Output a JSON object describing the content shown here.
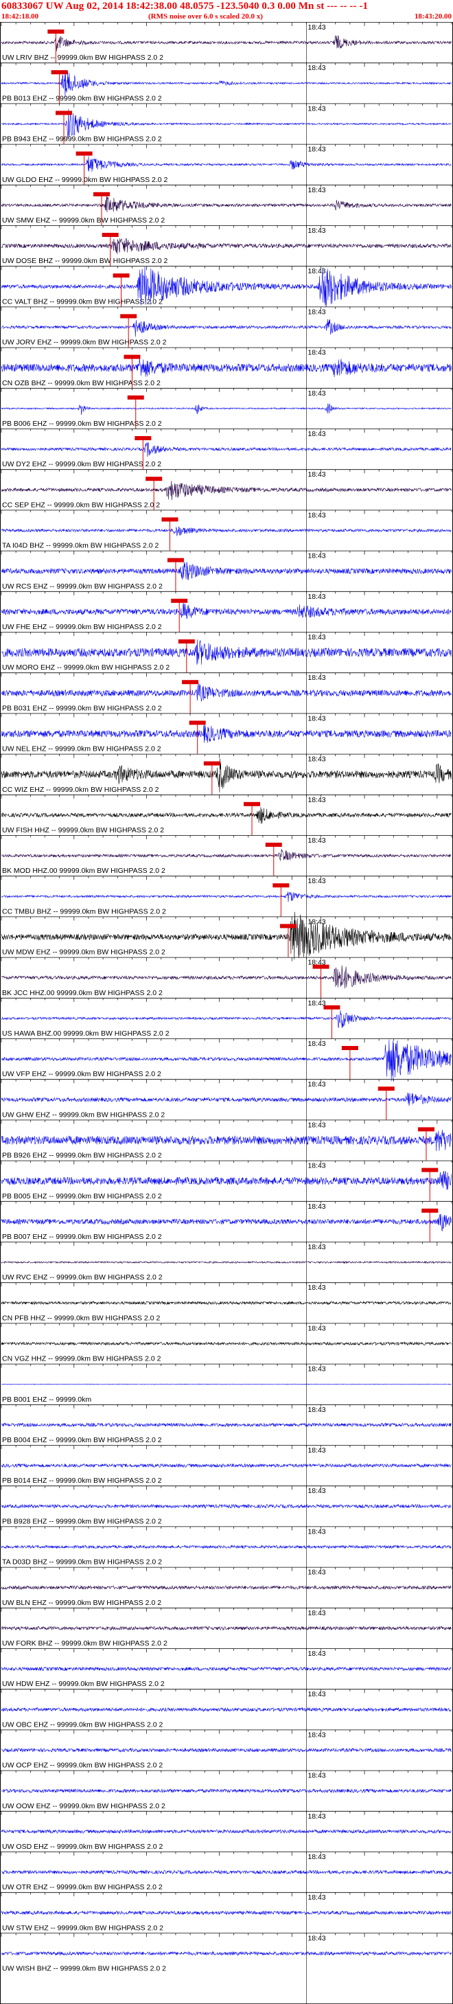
{
  "header": {
    "title": "60833067 UW Aug 02, 2014 18:42:38.00   48.0575 -123.5040   0.3 0.00 Mn st --- -- --   -1",
    "subtitle": "(RMS noise over 6.0 s scaled 20.0 x)",
    "time_start": "18:42:18.00",
    "time_end": "18:43:20.00"
  },
  "colors": {
    "header_red": "#ee0000",
    "trace_blue": "#0000ee",
    "trace_dark": "#220044",
    "trace_black": "#000000",
    "pick": "#dd0000",
    "grid": "#000000"
  },
  "chart_data": {
    "type": "seismogram",
    "title": "60833067 UW Aug 02, 2014 18:42:38.00   48.0575 -123.5040   0.3 0.00 Mn st --- -- --   -1",
    "subtitle": "(RMS noise over 6.0 s scaled 20.0 x)",
    "x_range_seconds": [
      0,
      62
    ],
    "time_axis": {
      "start": "18:42:18.00",
      "end": "18:43:20.00",
      "minute_mark": "18:43",
      "minute_mark_seconds": 42
    },
    "grid": true,
    "series": [
      {
        "label": "UW LRIV BHZ -- 99999.0km BW  HIGHPASS  2.0  2",
        "color": "dark",
        "pick_seconds": 7.5,
        "amp": 0.35,
        "noise": 0.1,
        "bursts": [
          [
            7.6,
            1.4,
            0.55
          ],
          [
            46,
            1.5,
            0.5
          ]
        ]
      },
      {
        "label": "PB B013 EHZ -- 99999.0km BW  HIGHPASS  2.0  2",
        "color": "blue",
        "pick_seconds": 8.0,
        "amp": 0.35,
        "noise": 0.06,
        "bursts": [
          [
            8.6,
            2.2,
            1.0
          ],
          [
            30,
            2,
            0.15
          ]
        ]
      },
      {
        "label": "PB B943 EHZ -- 99999.0km BW  HIGHPASS  2.0  2",
        "color": "blue",
        "pick_seconds": 8.6,
        "amp": 0.35,
        "noise": 0.06,
        "bursts": [
          [
            9.2,
            2.5,
            1.1
          ]
        ]
      },
      {
        "label": "UW GLDO EHZ -- 99999.0km BW  HIGHPASS  2.0  2",
        "color": "blue",
        "pick_seconds": 11.4,
        "amp": 0.35,
        "noise": 0.07,
        "bursts": [
          [
            12,
            2.5,
            0.6
          ],
          [
            40,
            1.5,
            0.35
          ]
        ]
      },
      {
        "label": "UW SMW EHZ -- 99999.0km BW  HIGHPASS  2.0  2",
        "color": "dark",
        "pick_seconds": 13.8,
        "amp": 0.35,
        "noise": 0.1,
        "bursts": [
          [
            14.5,
            3,
            0.6
          ],
          [
            46,
            2,
            0.3
          ]
        ]
      },
      {
        "label": "UW DOSE BHZ -- 99999.0km BW  HIGHPASS  2.0  2",
        "color": "dark",
        "pick_seconds": 15.0,
        "amp": 0.35,
        "noise": 0.14,
        "bursts": [
          [
            15.5,
            5,
            0.55
          ]
        ]
      },
      {
        "label": "CC VALT BHZ -- 99999.0km BW  HIGHPASS  2.0  2",
        "color": "blue",
        "pick_seconds": 16.5,
        "amp": 0.4,
        "noise": 0.12,
        "bursts": [
          [
            19,
            6,
            1.3
          ],
          [
            44,
            4,
            1.4
          ]
        ]
      },
      {
        "label": "UW JORV EHZ -- 99999.0km BW  HIGHPASS  2.0  2",
        "color": "blue",
        "pick_seconds": 17.5,
        "amp": 0.35,
        "noise": 0.1,
        "bursts": [
          [
            18.5,
            1.5,
            0.7
          ],
          [
            45,
            1,
            0.6
          ]
        ]
      },
      {
        "label": "CN OZB BHZ -- 99999.0km BW  HIGHPASS  2.0  2",
        "color": "blue",
        "pick_seconds": 18.0,
        "amp": 0.35,
        "noise": 0.28,
        "bursts": [
          [
            19,
            2,
            0.6
          ],
          [
            46,
            2,
            0.6
          ]
        ]
      },
      {
        "label": "PB B006 EHZ -- 99999.0km BW  HIGHPASS  2.0  2",
        "color": "blue",
        "pick_seconds": 18.5,
        "amp": 0.35,
        "noise": 0.05,
        "bursts": [
          [
            11,
            0.4,
            0.5
          ],
          [
            27,
            0.4,
            0.5
          ],
          [
            45,
            0.4,
            0.5
          ]
        ]
      },
      {
        "label": "UW DY2 EHZ -- 99999.0km BW  HIGHPASS  2.0  2",
        "color": "blue",
        "pick_seconds": 19.5,
        "amp": 0.35,
        "noise": 0.1,
        "bursts": [
          [
            20,
            1.5,
            0.5
          ]
        ]
      },
      {
        "label": "CC SEP EHZ -- 99999.0km BW  HIGHPASS  2.0  2",
        "color": "dark",
        "pick_seconds": 21.0,
        "amp": 0.35,
        "noise": 0.12,
        "bursts": [
          [
            23,
            4,
            0.7
          ]
        ]
      },
      {
        "label": "TA I04D BHZ -- 99999.0km BW  HIGHPASS  2.0  2",
        "color": "blue",
        "pick_seconds": 23.2,
        "amp": 0.35,
        "noise": 0.1,
        "bursts": [
          [
            24,
            1.5,
            0.4
          ]
        ]
      },
      {
        "label": "UW RCS EHZ -- 99999.0km BW  HIGHPASS  2.0  2",
        "color": "blue",
        "pick_seconds": 24.0,
        "amp": 0.35,
        "noise": 0.18,
        "bursts": [
          [
            25,
            2.5,
            0.6
          ]
        ]
      },
      {
        "label": "UW FHE EHZ -- 99999.0km BW  HIGHPASS  2.0  2",
        "color": "blue",
        "pick_seconds": 24.5,
        "amp": 0.35,
        "noise": 0.2,
        "bursts": [
          [
            25,
            1.5,
            0.5
          ],
          [
            41,
            3,
            0.35
          ]
        ]
      },
      {
        "label": "UW MORO EHZ -- 99999.0km BW  HIGHPASS  2.0  2",
        "color": "blue",
        "pick_seconds": 25.5,
        "amp": 0.35,
        "noise": 0.3,
        "bursts": [
          [
            27,
            3,
            0.7
          ]
        ]
      },
      {
        "label": "PB B031 EHZ -- 99999.0km BW  HIGHPASS  2.0  2",
        "color": "blue",
        "pick_seconds": 26.0,
        "amp": 0.35,
        "noise": 0.22,
        "bursts": [
          [
            27,
            2,
            0.5
          ]
        ]
      },
      {
        "label": "UW NEL EHZ -- 99999.0km BW  HIGHPASS  2.0  2",
        "color": "blue",
        "pick_seconds": 27.0,
        "amp": 0.35,
        "noise": 0.25,
        "bursts": [
          [
            28,
            2,
            0.5
          ]
        ]
      },
      {
        "label": "CC WIZ EHZ -- 99999.0km BW  HIGHPASS  2.0  2",
        "color": "black",
        "pick_seconds": 29.0,
        "amp": 0.35,
        "noise": 0.26,
        "bursts": [
          [
            30,
            1.2,
            1.1
          ],
          [
            16,
            2,
            0.5
          ],
          [
            60,
            1,
            0.6
          ]
        ]
      },
      {
        "label": "UW FISH HHZ -- 99999.0km BW  HIGHPASS  2.0  2",
        "color": "black",
        "pick_seconds": 34.5,
        "amp": 0.35,
        "noise": 0.14,
        "bursts": [
          [
            35.5,
            1.5,
            0.6
          ]
        ]
      },
      {
        "label": "BK MOD HHZ.00 99999.0km BW  HIGHPASS  2.0  2",
        "color": "dark",
        "pick_seconds": 37.5,
        "amp": 0.35,
        "noise": 0.1,
        "bursts": [
          [
            38.5,
            2,
            0.4
          ]
        ]
      },
      {
        "label": "CC TMBU BHZ -- 99999.0km BW  HIGHPASS  2.0  2",
        "color": "blue",
        "pick_seconds": 38.5,
        "amp": 0.35,
        "noise": 0.08,
        "bursts": [
          [
            39.5,
            1.5,
            0.4
          ]
        ]
      },
      {
        "label": "UW MDW EHZ -- 99999.0km BW  HIGHPASS  2.0  2",
        "color": "black",
        "pick_seconds": 39.5,
        "amp": 0.4,
        "noise": 0.18,
        "bursts": [
          [
            40,
            6,
            1.5
          ]
        ]
      },
      {
        "label": "BK JCC HHZ.00 99999.0km BW  HIGHPASS  2.0  2",
        "color": "dark",
        "pick_seconds": 44.0,
        "amp": 0.35,
        "noise": 0.12,
        "bursts": [
          [
            46,
            3,
            1.1
          ]
        ]
      },
      {
        "label": "US HAWA BHZ.00 99999.0km BW  HIGHPASS  2.0  2",
        "color": "blue",
        "pick_seconds": 45.5,
        "amp": 0.35,
        "noise": 0.08,
        "bursts": [
          [
            46.5,
            1.5,
            0.8
          ]
        ]
      },
      {
        "label": "UW VFP EHZ -- 99999.0km BW  HIGHPASS  2.0  2",
        "color": "blue",
        "pick_seconds": 48.0,
        "amp": 0.4,
        "noise": 0.1,
        "bursts": [
          [
            53,
            6,
            1.5
          ]
        ]
      },
      {
        "label": "UW GHW EHZ -- 99999.0km BW  HIGHPASS  2.0  2",
        "color": "blue",
        "pick_seconds": 53.0,
        "amp": 0.35,
        "noise": 0.14,
        "bursts": [
          [
            56,
            2,
            0.5
          ]
        ]
      },
      {
        "label": "PB B926 EHZ -- 99999.0km BW  HIGHPASS  2.0  2",
        "color": "blue",
        "pick_seconds": 58.5,
        "amp": 0.35,
        "noise": 0.3,
        "bursts": [
          [
            60,
            2,
            0.7
          ]
        ]
      },
      {
        "label": "PB B005 EHZ -- 99999.0km BW  HIGHPASS  2.0  2",
        "color": "blue",
        "pick_seconds": 59.0,
        "amp": 0.35,
        "noise": 0.26,
        "bursts": [
          [
            60.5,
            1.5,
            0.7
          ]
        ]
      },
      {
        "label": "PB B007 EHZ -- 99999.0km BW  HIGHPASS  2.0  2",
        "color": "blue",
        "pick_seconds": 59.0,
        "amp": 0.35,
        "noise": 0.18,
        "bursts": [
          [
            60.5,
            1.2,
            0.6
          ]
        ]
      },
      {
        "label": "UW RVC EHZ -- 99999.0km BW  HIGHPASS  2.0  2",
        "color": "dark",
        "pick_seconds": null,
        "amp": 0.35,
        "noise": 0.06,
        "bursts": []
      },
      {
        "label": "CN PFB HHZ -- 99999.0km BW  HIGHPASS  2.0  2",
        "color": "black",
        "pick_seconds": null,
        "amp": 0.35,
        "noise": 0.1,
        "bursts": []
      },
      {
        "label": "CN VGZ HHZ -- 99999.0km BW  HIGHPASS  2.0  2",
        "color": "black",
        "pick_seconds": null,
        "amp": 0.35,
        "noise": 0.1,
        "bursts": []
      },
      {
        "label": "PB B001 EHZ -- 99999.0km",
        "color": "blue",
        "pick_seconds": null,
        "amp": 0.35,
        "noise": 0.02,
        "bursts": []
      },
      {
        "label": "PB B004 EHZ -- 99999.0km BW  HIGHPASS  2.0  2",
        "color": "blue",
        "pick_seconds": null,
        "amp": 0.35,
        "noise": 0.12,
        "bursts": []
      },
      {
        "label": "PB B014 EHZ -- 99999.0km BW  HIGHPASS  2.0  2",
        "color": "blue",
        "pick_seconds": null,
        "amp": 0.35,
        "noise": 0.12,
        "bursts": []
      },
      {
        "label": "PB B928 EHZ -- 99999.0km BW  HIGHPASS  2.0  2",
        "color": "blue",
        "pick_seconds": null,
        "amp": 0.35,
        "noise": 0.12,
        "bursts": []
      },
      {
        "label": "TA D03D BHZ -- 99999.0km BW  HIGHPASS  2.0  2",
        "color": "blue",
        "pick_seconds": null,
        "amp": 0.35,
        "noise": 0.1,
        "bursts": []
      },
      {
        "label": "UW BLN EHZ -- 99999.0km BW  HIGHPASS  2.0  2",
        "color": "dark",
        "pick_seconds": null,
        "amp": 0.35,
        "noise": 0.12,
        "bursts": []
      },
      {
        "label": "UW FORK BHZ -- 99999.0km BW  HIGHPASS  2.0  2",
        "color": "dark",
        "pick_seconds": null,
        "amp": 0.35,
        "noise": 0.12,
        "bursts": []
      },
      {
        "label": "UW HDW EHZ -- 99999.0km BW  HIGHPASS  2.0  2",
        "color": "blue",
        "pick_seconds": null,
        "amp": 0.35,
        "noise": 0.12,
        "bursts": []
      },
      {
        "label": "UW OBC EHZ -- 99999.0km BW  HIGHPASS  2.0  2",
        "color": "blue",
        "pick_seconds": null,
        "amp": 0.35,
        "noise": 0.12,
        "bursts": []
      },
      {
        "label": "UW OCP EHZ -- 99999.0km BW  HIGHPASS  2.0  2",
        "color": "blue",
        "pick_seconds": null,
        "amp": 0.35,
        "noise": 0.12,
        "bursts": []
      },
      {
        "label": "UW OOW EHZ -- 99999.0km BW  HIGHPASS  2.0  2",
        "color": "blue",
        "pick_seconds": null,
        "amp": 0.35,
        "noise": 0.12,
        "bursts": []
      },
      {
        "label": "UW OSD EHZ -- 99999.0km BW  HIGHPASS  2.0  2",
        "color": "blue",
        "pick_seconds": null,
        "amp": 0.35,
        "noise": 0.12,
        "bursts": []
      },
      {
        "label": "UW OTR EHZ -- 99999.0km BW  HIGHPASS  2.0  2",
        "color": "blue",
        "pick_seconds": null,
        "amp": 0.35,
        "noise": 0.12,
        "bursts": []
      },
      {
        "label": "UW STW EHZ -- 99999.0km BW  HIGHPASS  2.0  2",
        "color": "blue",
        "pick_seconds": null,
        "amp": 0.35,
        "noise": 0.12,
        "bursts": []
      },
      {
        "label": "UW WISH BHZ -- 99999.0km BW  HIGHPASS  2.0  2",
        "color": "blue",
        "pick_seconds": null,
        "amp": 0.35,
        "noise": 0.12,
        "bursts": []
      }
    ]
  }
}
